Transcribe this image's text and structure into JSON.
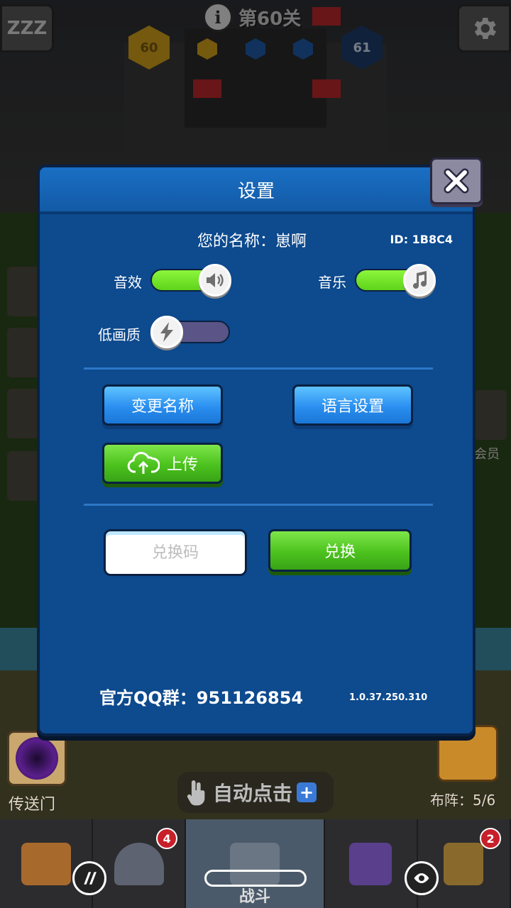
{
  "hud": {
    "level_text": "第60关",
    "level_current": "60",
    "level_next": "61",
    "sleep_label": "ZZZ"
  },
  "dialog": {
    "title": "设置",
    "player_name": "您的名称：崽啊",
    "player_id": "ID: 1B8C4",
    "sound_label": "音效",
    "sound_on": true,
    "music_label": "音乐",
    "music_on": true,
    "low_quality_label": "低画质",
    "low_quality_on": false,
    "rename_label": "变更名称",
    "language_label": "语言设置",
    "upload_label": "上传",
    "redeem_placeholder": "兑换码",
    "redeem_label": "兑换",
    "qq_group": "官方QQ群：951126854",
    "version": "1.0.37.250.310"
  },
  "bottom": {
    "portal_label": "传送门",
    "auto_click_label": "自动点击",
    "formation_label": "布阵：5/6",
    "member_label": "会员",
    "tabs": [
      {
        "name": "chest",
        "badge": ""
      },
      {
        "name": "hero",
        "badge": "4"
      },
      {
        "name": "battle",
        "label": "战斗"
      },
      {
        "name": "book",
        "badge": ""
      },
      {
        "name": "necklace",
        "badge": "2"
      }
    ]
  },
  "colors": {
    "dialog_bg": "#0d4a8e",
    "header_bg": "#1a6fc4",
    "toggle_on": "#6be022",
    "toggle_off": "#5b5487",
    "button_blue": "#2a8ff0",
    "button_green": "#4cc21e"
  }
}
